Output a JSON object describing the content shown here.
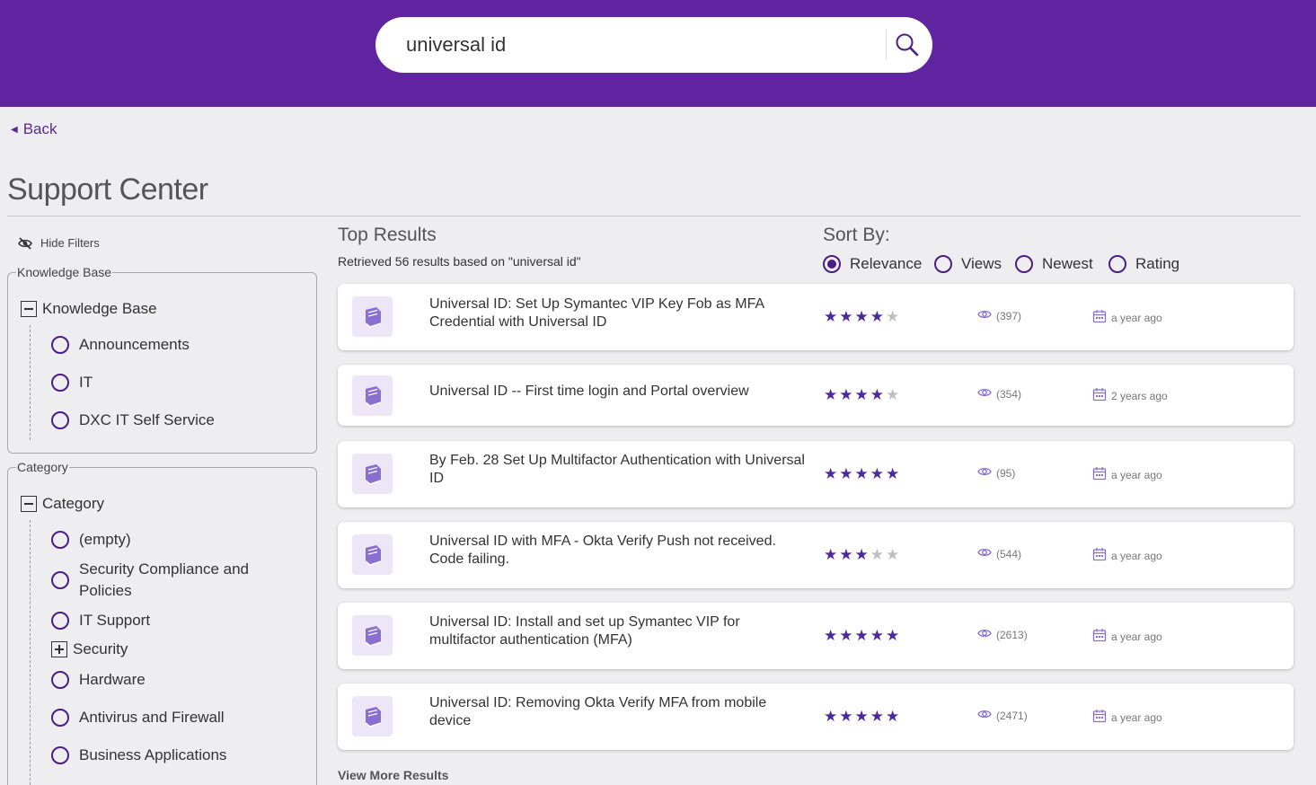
{
  "search": {
    "query": "universal id"
  },
  "nav": {
    "back_label": "Back"
  },
  "page": {
    "title": "Support Center"
  },
  "filters": {
    "hide_label": "Hide Filters",
    "knowledge_base": {
      "legend": "Knowledge Base",
      "header": "Knowledge Base",
      "options": [
        "Announcements",
        "IT",
        "DXC IT Self Service"
      ]
    },
    "category": {
      "legend": "Category",
      "header": "Category",
      "options": [
        "(empty)",
        "Security Compliance and Policies",
        "IT Support",
        "Security",
        "Hardware",
        "Antivirus and Firewall",
        "Business Applications"
      ]
    }
  },
  "results": {
    "heading": "Top Results",
    "summary": "Retrieved 56 results based on \"universal id\"",
    "items": [
      {
        "title": "Universal ID: Set Up Symantec VIP Key Fob as MFA Credential with Universal ID",
        "rating": 4,
        "views": "(397)",
        "age": "a year ago"
      },
      {
        "title": "Universal ID -- First time login and Portal overview",
        "rating": 4,
        "views": "(354)",
        "age": "2 years ago"
      },
      {
        "title": "By Feb. 28 Set Up Multifactor Authentication with Universal ID",
        "rating": 5,
        "views": "(95)",
        "age": "a year ago"
      },
      {
        "title": "Universal ID with MFA - Okta Verify Push not received. Code failing.",
        "rating": 3,
        "views": "(544)",
        "age": "a year ago"
      },
      {
        "title": "Universal ID: Install and set up Symantec VIP for multifactor authentication (MFA)",
        "rating": 5,
        "views": "(2613)",
        "age": "a year ago"
      },
      {
        "title": "Universal ID: Removing Okta Verify MFA from mobile device",
        "rating": 5,
        "views": "(2471)",
        "age": "a year ago"
      }
    ],
    "view_more_label": "View More Results"
  },
  "sort": {
    "label": "Sort By:",
    "options": [
      "Relevance",
      "Views",
      "Newest",
      "Rating"
    ],
    "selected": "Relevance"
  },
  "colors": {
    "brand": "#6024a1",
    "accent": "#4b1d87",
    "star_on": "#4b2aa0",
    "star_off": "#bfbfbf",
    "icon": "#8a6fd1"
  },
  "icons": {
    "search": "magnifier-icon",
    "hide": "eye-slash-icon",
    "article": "book-icon",
    "views": "eye-icon",
    "date": "calendar-icon",
    "rating": "star-icon"
  }
}
